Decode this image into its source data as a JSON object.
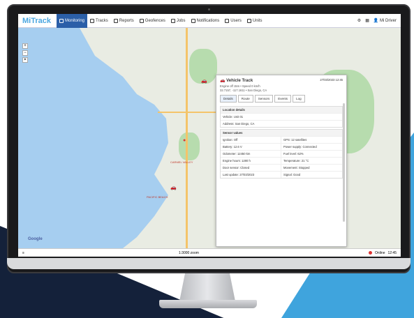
{
  "app": {
    "logo_main": "Mi",
    "logo_accent": "Track"
  },
  "nav": [
    {
      "label": "Monitoring",
      "active": true
    },
    {
      "label": "Tracks"
    },
    {
      "label": "Reports"
    },
    {
      "label": "Geofences"
    },
    {
      "label": "Jobs"
    },
    {
      "label": "Notifications"
    },
    {
      "label": "Users"
    },
    {
      "label": "Units"
    }
  ],
  "topbar_right": {
    "user": "Mi Driver"
  },
  "map": {
    "tools": [
      "+",
      "−",
      "⌖"
    ],
    "label1": "CARMEL VALLEY",
    "label2": "PACIFIC BEACH",
    "google": "Google"
  },
  "panel": {
    "title": "Vehicle Track",
    "timestamp": "27/03/2023 12:45",
    "subtitle": "Engine off 15m • Speed 0 km/h",
    "coords": "32.7157, -117.1611 • San Diego, CA",
    "tabs": [
      "Details",
      "Route",
      "Sensors",
      "Events",
      "Log"
    ],
    "section1": {
      "heading": "Location details",
      "rows": [
        "Vehicle: Unit 01",
        "Address: San Diego, CA"
      ]
    },
    "section2": {
      "heading": "Sensor values",
      "rows": [
        "Ignition: Off",
        "GPS: 12 satellites",
        "Battery: 12.6 V",
        "Power supply: Connected",
        "Odometer: 12450 km",
        "Fuel level: 62%",
        "Engine hours: 1280 h",
        "Temperature: 21 °C",
        "Door sensor: Closed",
        "Movement: Stopped",
        "Last update: 27/03/2023",
        "Signal: Good"
      ]
    }
  },
  "status": {
    "center": "1:3000 zoom",
    "right1": "Online",
    "right2": "12:45"
  }
}
